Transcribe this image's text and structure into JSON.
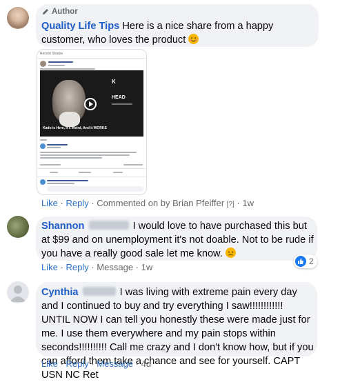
{
  "comments": [
    {
      "author_badge": "Author",
      "name": "Quality Life Tips",
      "text": "Here is a nice share from a happy customer, who loves the product",
      "actions": {
        "like": "Like",
        "reply": "Reply",
        "commented_by": "Commented on by Brian Pfeiffer",
        "help": "[?]",
        "time": "1w"
      },
      "thumbnail": {
        "header": "Recent Shares",
        "video_brand": "K",
        "video_title": "HEAD",
        "video_caption": "Kado is Here, it's Weird, And it WORKS"
      }
    },
    {
      "name": "Shannon",
      "text": "I would love to have purchased this but at $99 and on unemployment it's not doable. Not to be rude if you have a really good sale let me know.",
      "actions": {
        "like": "Like",
        "reply": "Reply",
        "message": "Message",
        "time": "1w"
      },
      "reaction_count": "2"
    },
    {
      "name": "Cynthia",
      "text": "I was living with extreme pain every day and I continued to buy and try everything I saw!!!!!!!!!!!! UNTIL NOW I can tell you honestly these were made just for me. I use them everywhere and my pain stops within seconds!!!!!!!!!! Call me crazy and I don't know how, but if you can afford them take a chance and see for yourself. CAPT USN NC Ret",
      "actions": {
        "like": "Like",
        "reply": "Reply",
        "message": "Message",
        "time": "4d"
      }
    }
  ],
  "colors": {
    "link": "#2b6fc8",
    "name": "#1d5cc8",
    "bubble": "#f0f2f5",
    "muted": "#65676b",
    "like_blue": "#1877f2"
  },
  "separator": "·"
}
